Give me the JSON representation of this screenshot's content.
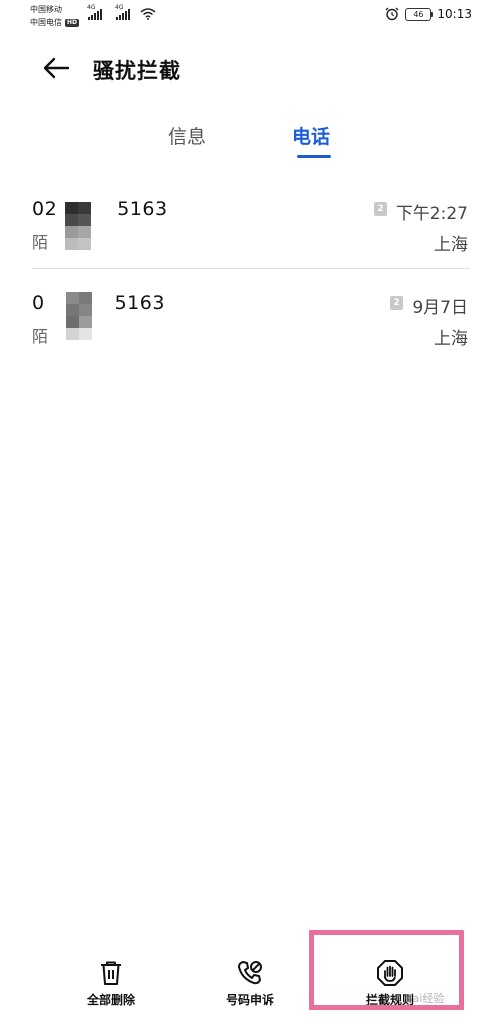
{
  "status_bar": {
    "carrier_1": "中国移动",
    "carrier_2": "中国电信",
    "hd_label": "HD",
    "network_1": "4G",
    "network_2": "4G",
    "battery": "46",
    "time": "10:13"
  },
  "header": {
    "back_icon": "arrow-left-icon",
    "title": "骚扰拦截"
  },
  "tabs": {
    "items": [
      {
        "label": "信息",
        "selected": false
      },
      {
        "label": "电话",
        "selected": true
      }
    ],
    "accent_color": "#1a5fd6"
  },
  "calls": [
    {
      "number_prefix": "02",
      "number_suffix": "5163",
      "label_prefix": "陌",
      "sim": "2",
      "time": "下午2:27",
      "location": "上海"
    },
    {
      "number_prefix": "0",
      "number_suffix": "5163",
      "label_prefix": "陌",
      "sim": "2",
      "time": "9月7日",
      "location": "上海"
    }
  ],
  "toolbar": {
    "delete_all": {
      "label": "全部删除",
      "icon": "trash-icon"
    },
    "number_appeal": {
      "label": "号码申诉",
      "icon": "phone-appeal-icon"
    },
    "block_rules": {
      "label": "拦截规则",
      "icon": "hand-shield-icon"
    }
  },
  "highlight_color": "#e9709c",
  "watermark": "Bai经验"
}
